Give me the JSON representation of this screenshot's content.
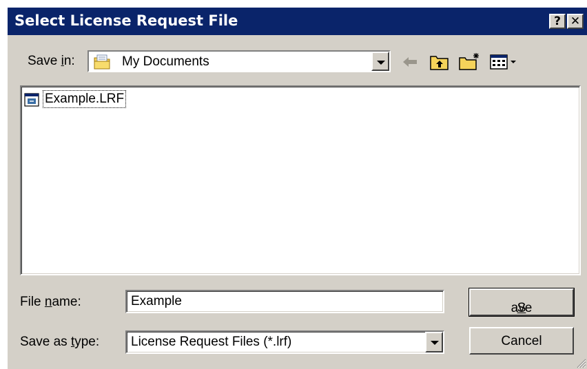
{
  "window": {
    "title": "Select License Request File",
    "help_glyph": "?",
    "close_glyph": "✕"
  },
  "save_in": {
    "label_pre": "Save ",
    "label_key": "i",
    "label_post": "n:",
    "value": "My Documents",
    "folder_icon": "folder-documents-icon"
  },
  "toolbar": {
    "back_icon": "back-arrow-icon",
    "up_icon": "up-folder-icon",
    "new_folder_icon": "new-folder-icon",
    "views_icon": "views-menu-icon"
  },
  "files": [
    {
      "name": "Example.LRF",
      "icon": "lrf-file-icon"
    }
  ],
  "file_name": {
    "label_pre": "File ",
    "label_key": "n",
    "label_post": "ame:",
    "value": "Example"
  },
  "save_as_type": {
    "label_pre": "Save as ",
    "label_key": "t",
    "label_post": "ype:",
    "value": "License Request Files (*.lrf)"
  },
  "buttons": {
    "save_key": "S",
    "save_rest": "ave",
    "cancel": "Cancel"
  },
  "colors": {
    "title_bar": "#0a246a",
    "face": "#d4d0c8",
    "selection_outline": "#000000"
  }
}
